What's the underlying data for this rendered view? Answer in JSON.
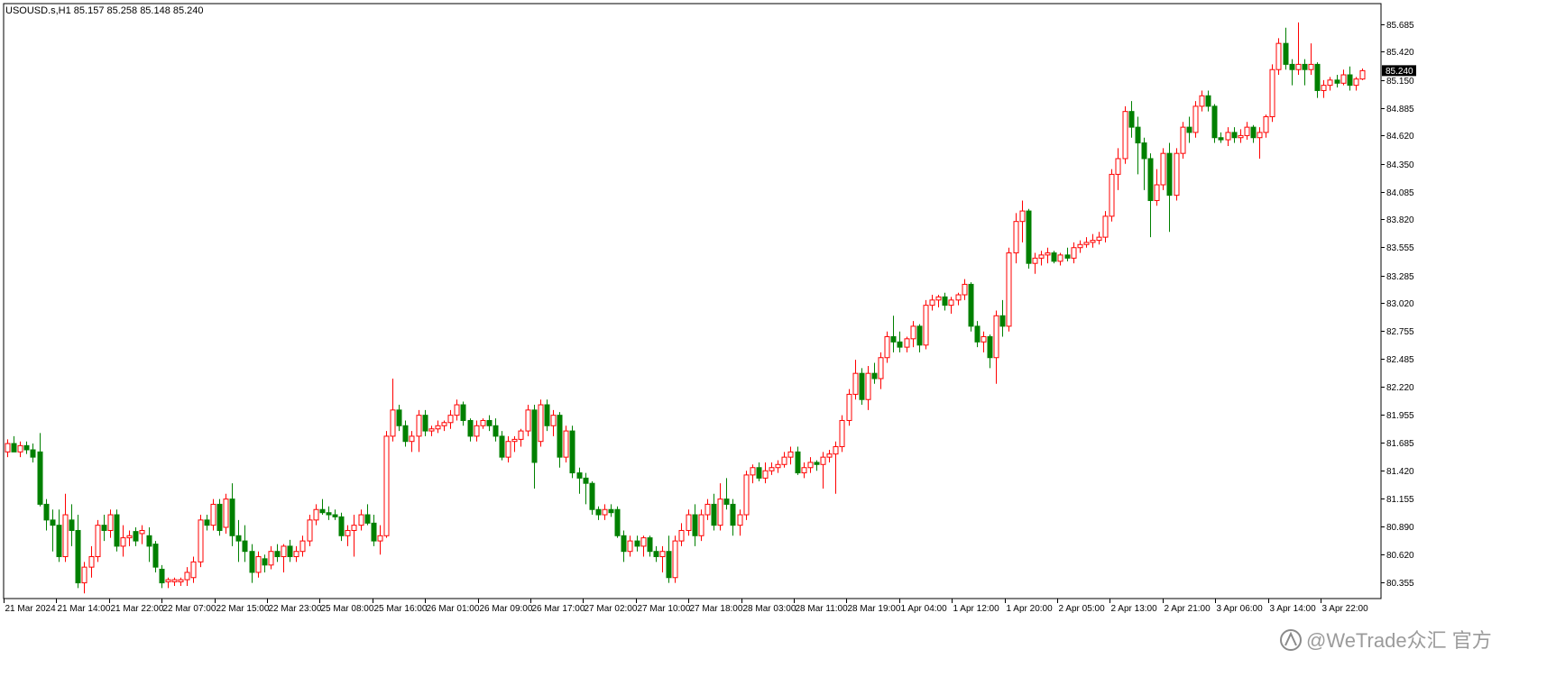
{
  "window": {
    "info_line": "USOUSD.s,H1  85.157 85.258 85.148 85.240",
    "watermark": "@WeTrade众汇 官方",
    "watermark_icon": "zhihu-icon"
  },
  "colors": {
    "background": "#ffffff",
    "frame": "#000000",
    "bull": "#ff0000",
    "bear": "#008000",
    "price_tag_bg": "#000000",
    "price_tag_text": "#ffffff"
  },
  "chart_data": {
    "type": "candlestick",
    "symbol": "USOUSD.s",
    "timeframe": "H1",
    "last_price": "85.240",
    "ylim": [
      80.2,
      85.88
    ],
    "y_ticks": [
      "85.685",
      "85.420",
      "85.150",
      "84.885",
      "84.620",
      "84.350",
      "84.085",
      "83.820",
      "83.555",
      "83.285",
      "83.020",
      "82.755",
      "82.485",
      "82.220",
      "81.955",
      "81.685",
      "81.420",
      "81.155",
      "80.890",
      "80.620",
      "80.355"
    ],
    "x_ticks": [
      "21 Mar 2024",
      "21 Mar 14:00",
      "21 Mar 22:00",
      "22 Mar 07:00",
      "22 Mar 15:00",
      "22 Mar 23:00",
      "25 Mar 08:00",
      "25 Mar 16:00",
      "26 Mar 01:00",
      "26 Mar 09:00",
      "26 Mar 17:00",
      "27 Mar 02:00",
      "27 Mar 10:00",
      "27 Mar 18:00",
      "28 Mar 03:00",
      "28 Mar 11:00",
      "28 Mar 19:00",
      "1 Apr 04:00",
      "1 Apr 12:00",
      "1 Apr 20:00",
      "2 Apr 05:00",
      "2 Apr 13:00",
      "2 Apr 21:00",
      "3 Apr 06:00",
      "3 Apr 14:00",
      "3 Apr 22:00"
    ],
    "candles": [
      [
        81.6,
        81.72,
        81.55,
        81.68
      ],
      [
        81.68,
        81.75,
        81.62,
        81.6
      ],
      [
        81.6,
        81.7,
        81.55,
        81.66
      ],
      [
        81.66,
        81.7,
        81.58,
        81.62
      ],
      [
        81.62,
        81.68,
        81.5,
        81.55
      ],
      [
        81.6,
        81.78,
        81.08,
        81.1
      ],
      [
        81.1,
        81.15,
        80.85,
        80.95
      ],
      [
        80.95,
        81.05,
        80.65,
        80.9
      ],
      [
        80.9,
        81.05,
        80.55,
        80.6
      ],
      [
        80.6,
        81.2,
        80.55,
        81.0
      ],
      [
        80.95,
        81.1,
        80.7,
        80.85
      ],
      [
        80.85,
        81.0,
        80.3,
        80.35
      ],
      [
        80.35,
        80.55,
        80.25,
        80.5
      ],
      [
        80.5,
        80.7,
        80.4,
        80.6
      ],
      [
        80.6,
        80.95,
        80.55,
        80.9
      ],
      [
        80.9,
        81.0,
        80.75,
        80.85
      ],
      [
        80.85,
        81.05,
        80.78,
        81.0
      ],
      [
        81.0,
        81.05,
        80.65,
        80.7
      ],
      [
        80.7,
        80.9,
        80.6,
        80.78
      ],
      [
        80.78,
        80.85,
        80.7,
        80.8
      ],
      [
        80.84,
        80.88,
        80.7,
        80.75
      ],
      [
        80.82,
        80.9,
        80.72,
        80.85
      ],
      [
        80.8,
        80.88,
        80.55,
        80.7
      ],
      [
        80.72,
        80.75,
        80.45,
        80.5
      ],
      [
        80.48,
        80.52,
        80.3,
        80.35
      ],
      [
        80.36,
        80.4,
        80.3,
        80.38
      ],
      [
        80.36,
        80.4,
        80.32,
        80.38
      ],
      [
        80.36,
        80.4,
        80.32,
        80.38
      ],
      [
        80.38,
        80.5,
        80.32,
        80.45
      ],
      [
        80.4,
        80.6,
        80.35,
        80.55
      ],
      [
        80.55,
        81.0,
        80.5,
        80.95
      ],
      [
        80.95,
        81.0,
        80.85,
        80.9
      ],
      [
        80.9,
        81.15,
        80.85,
        81.1
      ],
      [
        81.1,
        81.15,
        80.8,
        80.85
      ],
      [
        80.88,
        81.2,
        80.82,
        81.15
      ],
      [
        81.15,
        81.3,
        80.7,
        80.8
      ],
      [
        80.8,
        80.95,
        80.55,
        80.75
      ],
      [
        80.75,
        80.9,
        80.55,
        80.65
      ],
      [
        80.65,
        80.72,
        80.35,
        80.45
      ],
      [
        80.45,
        80.65,
        80.4,
        80.6
      ],
      [
        80.58,
        80.62,
        80.45,
        80.52
      ],
      [
        80.52,
        80.7,
        80.48,
        80.65
      ],
      [
        80.65,
        80.72,
        80.55,
        80.6
      ],
      [
        80.6,
        80.72,
        80.45,
        80.7
      ],
      [
        80.7,
        80.76,
        80.55,
        80.6
      ],
      [
        80.6,
        80.7,
        80.55,
        80.65
      ],
      [
        80.65,
        80.8,
        80.6,
        80.75
      ],
      [
        80.75,
        81.0,
        80.7,
        80.95
      ],
      [
        80.95,
        81.1,
        80.9,
        81.05
      ],
      [
        81.05,
        81.15,
        81.0,
        81.02
      ],
      [
        81.02,
        81.08,
        80.95,
        81.0
      ],
      [
        81.0,
        81.05,
        80.95,
        80.98
      ],
      [
        80.98,
        81.02,
        80.75,
        80.8
      ],
      [
        80.8,
        80.9,
        80.7,
        80.85
      ],
      [
        80.85,
        81.0,
        80.6,
        80.9
      ],
      [
        80.9,
        81.05,
        80.85,
        81.0
      ],
      [
        81.0,
        81.1,
        80.9,
        80.92
      ],
      [
        80.92,
        81.0,
        80.7,
        80.75
      ],
      [
        80.75,
        80.9,
        80.62,
        80.8
      ],
      [
        80.8,
        81.8,
        80.78,
        81.75
      ],
      [
        81.75,
        82.3,
        81.7,
        82.0
      ],
      [
        82.0,
        82.05,
        81.8,
        81.85
      ],
      [
        81.85,
        81.9,
        81.65,
        81.7
      ],
      [
        81.7,
        81.8,
        81.6,
        81.75
      ],
      [
        81.75,
        82.0,
        81.6,
        81.95
      ],
      [
        81.95,
        82.0,
        81.75,
        81.8
      ],
      [
        81.8,
        81.85,
        81.75,
        81.82
      ],
      [
        81.82,
        81.9,
        81.78,
        81.85
      ],
      [
        81.85,
        81.9,
        81.8,
        81.88
      ],
      [
        81.88,
        82.0,
        81.82,
        81.95
      ],
      [
        81.95,
        82.1,
        81.9,
        82.05
      ],
      [
        82.05,
        82.08,
        81.85,
        81.9
      ],
      [
        81.9,
        81.92,
        81.7,
        81.75
      ],
      [
        81.75,
        81.9,
        81.7,
        81.85
      ],
      [
        81.85,
        81.92,
        81.82,
        81.9
      ],
      [
        81.9,
        81.95,
        81.8,
        81.85
      ],
      [
        81.85,
        81.92,
        81.7,
        81.75
      ],
      [
        81.75,
        81.8,
        81.52,
        81.55
      ],
      [
        81.55,
        81.75,
        81.5,
        81.7
      ],
      [
        81.7,
        81.75,
        81.6,
        81.72
      ],
      [
        81.72,
        81.82,
        81.65,
        81.8
      ],
      [
        81.8,
        82.05,
        81.75,
        82.0
      ],
      [
        82.0,
        82.05,
        81.25,
        81.5
      ],
      [
        81.7,
        82.1,
        81.65,
        82.05
      ],
      [
        82.05,
        82.1,
        81.8,
        81.85
      ],
      [
        81.85,
        82.0,
        81.75,
        81.95
      ],
      [
        81.95,
        81.98,
        81.45,
        81.55
      ],
      [
        81.55,
        81.85,
        81.5,
        81.8
      ],
      [
        81.8,
        81.85,
        81.35,
        81.4
      ],
      [
        81.4,
        81.45,
        81.2,
        81.35
      ],
      [
        81.35,
        81.4,
        81.1,
        81.3
      ],
      [
        81.3,
        81.32,
        81.0,
        81.05
      ],
      [
        81.05,
        81.08,
        80.95,
        81.0
      ],
      [
        81.0,
        81.1,
        80.95,
        81.05
      ],
      [
        81.05,
        81.1,
        80.98,
        81.02
      ],
      [
        81.05,
        81.08,
        80.78,
        80.8
      ],
      [
        80.8,
        80.85,
        80.55,
        80.65
      ],
      [
        80.65,
        80.8,
        80.6,
        80.75
      ],
      [
        80.75,
        80.8,
        80.65,
        80.7
      ],
      [
        80.7,
        80.8,
        80.6,
        80.78
      ],
      [
        80.78,
        80.8,
        80.6,
        80.65
      ],
      [
        80.65,
        80.7,
        80.55,
        80.6
      ],
      [
        80.6,
        80.7,
        80.45,
        80.65
      ],
      [
        80.65,
        80.8,
        80.35,
        80.4
      ],
      [
        80.4,
        80.8,
        80.35,
        80.75
      ],
      [
        80.75,
        80.92,
        80.7,
        80.85
      ],
      [
        80.85,
        81.05,
        80.8,
        81.0
      ],
      [
        81.0,
        81.1,
        80.7,
        80.8
      ],
      [
        80.8,
        81.05,
        80.75,
        81.0
      ],
      [
        81.0,
        81.15,
        80.95,
        81.1
      ],
      [
        81.1,
        81.2,
        80.85,
        80.9
      ],
      [
        80.9,
        81.3,
        80.85,
        81.15
      ],
      [
        81.15,
        81.35,
        81.05,
        81.1
      ],
      [
        81.1,
        81.15,
        80.8,
        80.9
      ],
      [
        80.9,
        81.05,
        80.8,
        81.0
      ],
      [
        81.0,
        81.42,
        80.95,
        81.38
      ],
      [
        81.38,
        81.48,
        81.3,
        81.45
      ],
      [
        81.45,
        81.5,
        81.32,
        81.35
      ],
      [
        81.35,
        81.5,
        81.3,
        81.42
      ],
      [
        81.42,
        81.5,
        81.38,
        81.45
      ],
      [
        81.45,
        81.52,
        81.4,
        81.48
      ],
      [
        81.48,
        81.6,
        81.45,
        81.55
      ],
      [
        81.55,
        81.65,
        81.48,
        81.6
      ],
      [
        81.6,
        81.65,
        81.38,
        81.4
      ],
      [
        81.4,
        81.5,
        81.35,
        81.45
      ],
      [
        81.45,
        81.55,
        81.4,
        81.5
      ],
      [
        81.5,
        81.52,
        81.42,
        81.48
      ],
      [
        81.48,
        81.6,
        81.25,
        81.55
      ],
      [
        81.55,
        81.62,
        81.5,
        81.58
      ],
      [
        81.58,
        81.7,
        81.2,
        81.65
      ],
      [
        81.65,
        81.95,
        81.6,
        81.9
      ],
      [
        81.9,
        82.2,
        81.85,
        82.15
      ],
      [
        82.15,
        82.48,
        82.1,
        82.35
      ],
      [
        82.35,
        82.4,
        82.05,
        82.1
      ],
      [
        82.1,
        82.42,
        82.0,
        82.35
      ],
      [
        82.35,
        82.45,
        82.25,
        82.3
      ],
      [
        82.3,
        82.55,
        82.2,
        82.5
      ],
      [
        82.5,
        82.75,
        82.45,
        82.7
      ],
      [
        82.7,
        82.9,
        82.55,
        82.65
      ],
      [
        82.65,
        82.75,
        82.55,
        82.6
      ],
      [
        82.6,
        82.7,
        82.55,
        82.68
      ],
      [
        82.68,
        82.85,
        82.6,
        82.8
      ],
      [
        82.8,
        82.82,
        82.55,
        82.62
      ],
      [
        82.62,
        83.05,
        82.58,
        83.0
      ],
      [
        83.0,
        83.1,
        82.95,
        83.05
      ],
      [
        83.05,
        83.1,
        82.98,
        83.08
      ],
      [
        83.08,
        83.12,
        82.95,
        83.0
      ],
      [
        83.0,
        83.08,
        82.92,
        83.05
      ],
      [
        83.05,
        83.12,
        83.0,
        83.1
      ],
      [
        83.1,
        83.25,
        83.05,
        83.2
      ],
      [
        83.2,
        83.22,
        82.75,
        82.8
      ],
      [
        82.8,
        82.85,
        82.6,
        82.65
      ],
      [
        82.65,
        82.75,
        82.55,
        82.7
      ],
      [
        82.7,
        82.72,
        82.4,
        82.5
      ],
      [
        82.5,
        82.95,
        82.25,
        82.9
      ],
      [
        82.9,
        83.05,
        82.7,
        82.8
      ],
      [
        82.8,
        83.55,
        82.75,
        83.5
      ],
      [
        83.5,
        83.88,
        83.4,
        83.8
      ],
      [
        83.8,
        84.0,
        83.6,
        83.9
      ],
      [
        83.9,
        83.92,
        83.35,
        83.4
      ],
      [
        83.4,
        83.5,
        83.3,
        83.45
      ],
      [
        83.45,
        83.52,
        83.38,
        83.48
      ],
      [
        83.48,
        83.55,
        83.4,
        83.5
      ],
      [
        83.5,
        83.52,
        83.4,
        83.42
      ],
      [
        83.42,
        83.5,
        83.38,
        83.48
      ],
      [
        83.48,
        83.55,
        83.42,
        83.45
      ],
      [
        83.45,
        83.6,
        83.4,
        83.55
      ],
      [
        83.55,
        83.62,
        83.5,
        83.58
      ],
      [
        83.58,
        83.65,
        83.55,
        83.6
      ],
      [
        83.6,
        83.68,
        83.55,
        83.62
      ],
      [
        83.62,
        83.7,
        83.58,
        83.65
      ],
      [
        83.65,
        83.9,
        83.6,
        83.85
      ],
      [
        83.85,
        84.3,
        83.8,
        84.25
      ],
      [
        84.25,
        84.5,
        84.1,
        84.4
      ],
      [
        84.4,
        84.9,
        84.35,
        84.85
      ],
      [
        84.85,
        84.95,
        84.6,
        84.7
      ],
      [
        84.7,
        84.8,
        84.25,
        84.55
      ],
      [
        84.55,
        84.6,
        84.1,
        84.4
      ],
      [
        84.4,
        84.45,
        83.65,
        84.0
      ],
      [
        84.0,
        84.3,
        83.95,
        84.15
      ],
      [
        84.15,
        84.5,
        84.1,
        84.45
      ],
      [
        84.45,
        84.55,
        83.7,
        84.05
      ],
      [
        84.05,
        84.5,
        84.0,
        84.45
      ],
      [
        84.45,
        84.75,
        84.4,
        84.7
      ],
      [
        84.7,
        84.8,
        84.55,
        84.65
      ],
      [
        84.65,
        84.95,
        84.6,
        84.9
      ],
      [
        84.9,
        85.05,
        84.85,
        85.0
      ],
      [
        85.0,
        85.05,
        84.85,
        84.9
      ],
      [
        84.9,
        84.92,
        84.55,
        84.6
      ],
      [
        84.6,
        84.65,
        84.55,
        84.58
      ],
      [
        84.58,
        84.7,
        84.52,
        84.65
      ],
      [
        84.65,
        84.7,
        84.55,
        84.6
      ],
      [
        84.6,
        84.68,
        84.55,
        84.62
      ],
      [
        84.62,
        84.75,
        84.58,
        84.7
      ],
      [
        84.7,
        84.72,
        84.55,
        84.6
      ],
      [
        84.6,
        84.7,
        84.4,
        84.65
      ],
      [
        84.65,
        84.82,
        84.6,
        84.8
      ],
      [
        84.8,
        85.3,
        84.75,
        85.25
      ],
      [
        85.25,
        85.55,
        85.2,
        85.5
      ],
      [
        85.5,
        85.65,
        85.25,
        85.3
      ],
      [
        85.3,
        85.35,
        85.1,
        85.25
      ],
      [
        85.25,
        85.7,
        85.2,
        85.3
      ],
      [
        85.3,
        85.35,
        85.1,
        85.25
      ],
      [
        85.25,
        85.5,
        85.2,
        85.3
      ],
      [
        85.3,
        85.32,
        84.98,
        85.05
      ],
      [
        85.05,
        85.15,
        84.98,
        85.1
      ],
      [
        85.1,
        85.18,
        85.05,
        85.15
      ],
      [
        85.15,
        85.2,
        85.08,
        85.12
      ],
      [
        85.12,
        85.25,
        85.1,
        85.2
      ],
      [
        85.2,
        85.28,
        85.05,
        85.1
      ],
      [
        85.1,
        85.18,
        85.05,
        85.16
      ],
      [
        85.16,
        85.26,
        85.15,
        85.24
      ]
    ]
  }
}
